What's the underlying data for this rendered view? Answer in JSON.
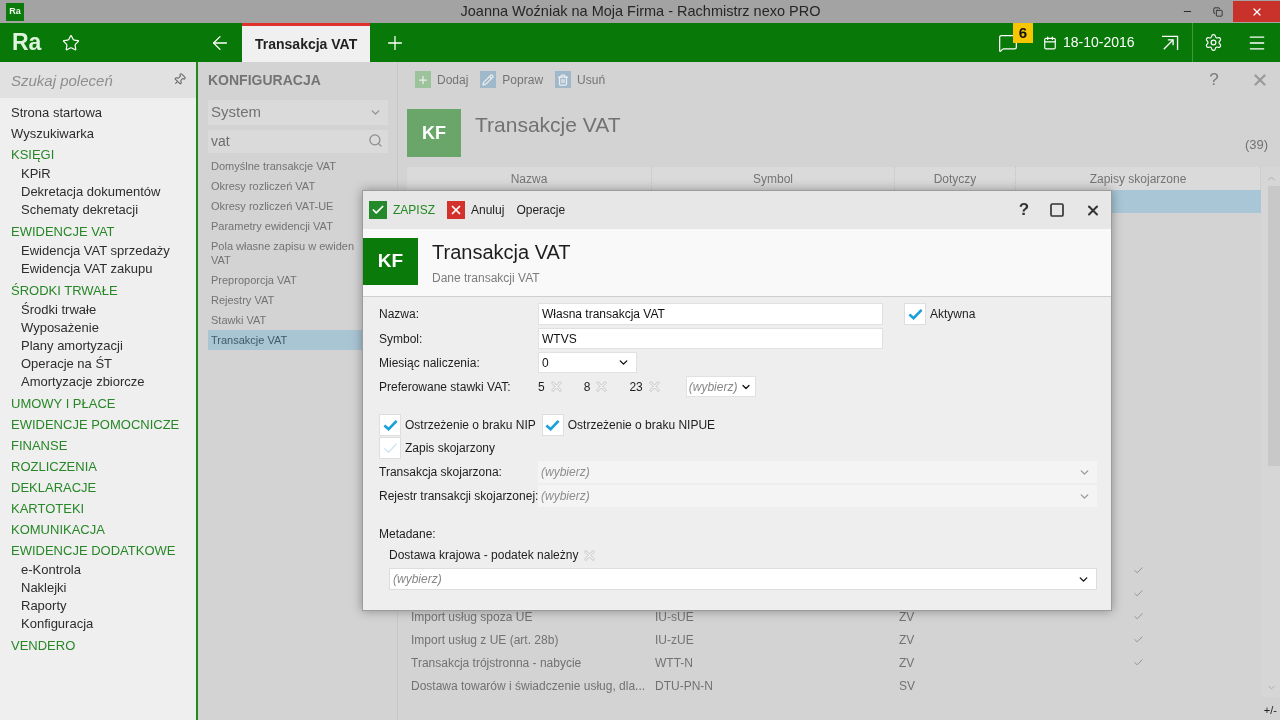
{
  "window": {
    "icon_text": "Ra",
    "title": "Joanna Woźniak na Moja Firma - Rachmistrz nexo PRO"
  },
  "app_bar": {
    "logo": "Ra",
    "tabs": [
      {
        "label": "Transakcja VAT",
        "selected": true
      }
    ],
    "badge": "6",
    "date": "18-10-2016"
  },
  "sidebar": {
    "search": {
      "placeholder": "Szukaj poleceń"
    },
    "items": [
      {
        "kind": "link",
        "label": "Strona startowa"
      },
      {
        "kind": "link",
        "label": "Wyszukiwarka"
      },
      {
        "kind": "section",
        "label": "KSIĘGI",
        "children": [
          {
            "label": "KPiR"
          },
          {
            "label": "Dekretacja dokumentów"
          },
          {
            "label": "Schematy dekretacji"
          }
        ]
      },
      {
        "kind": "section",
        "label": "EWIDENCJE VAT",
        "children": [
          {
            "label": "Ewidencja VAT sprzedaży"
          },
          {
            "label": "Ewidencja VAT zakupu"
          }
        ]
      },
      {
        "kind": "section",
        "label": "ŚRODKI TRWAŁE",
        "children": [
          {
            "label": "Środki trwałe"
          },
          {
            "label": "Wyposażenie"
          },
          {
            "label": "Plany amortyzacji"
          },
          {
            "label": "Operacje na ŚT"
          },
          {
            "label": "Amortyzacje zbiorcze"
          }
        ]
      },
      {
        "kind": "section",
        "label": "UMOWY I PŁACE"
      },
      {
        "kind": "section",
        "label": "EWIDENCJE POMOCNICZE"
      },
      {
        "kind": "section",
        "label": "FINANSE"
      },
      {
        "kind": "section",
        "label": "ROZLICZENIA"
      },
      {
        "kind": "section",
        "label": "DEKLARACJE"
      },
      {
        "kind": "section",
        "label": "KARTOTEKI"
      },
      {
        "kind": "section",
        "label": "KOMUNIKACJA"
      },
      {
        "kind": "section",
        "label": "EWIDENCJE DODATKOWE",
        "children": [
          {
            "label": "e-Kontrola"
          },
          {
            "label": "Naklejki"
          },
          {
            "label": "Raporty"
          },
          {
            "label": "Konfiguracja"
          }
        ]
      },
      {
        "kind": "section",
        "label": "VENDERO"
      }
    ]
  },
  "config_panel": {
    "title": "KONFIGURACJA",
    "category": "System",
    "search": {
      "value": "vat"
    },
    "items": [
      {
        "label": "Domyślne transakcje VAT",
        "selected": false
      },
      {
        "label": "Okresy rozliczeń VAT",
        "selected": false
      },
      {
        "label": "Okresy rozliczeń VAT-UE",
        "selected": false
      },
      {
        "label": "Parametry ewidencji VAT",
        "selected": false
      },
      {
        "label": "Pola własne zapisu w ewiden VAT",
        "selected": false
      },
      {
        "label": "Preproporcja VAT",
        "selected": false
      },
      {
        "label": "Rejestry VAT",
        "selected": false
      },
      {
        "label": "Stawki VAT",
        "selected": false
      },
      {
        "label": "Transakcje VAT",
        "selected": true
      }
    ]
  },
  "main": {
    "toolbar": [
      {
        "kind": "add",
        "label": "Dodaj"
      },
      {
        "kind": "edit",
        "label": "Popraw"
      },
      {
        "kind": "delete",
        "label": "Usuń"
      }
    ],
    "help": "?",
    "tile": "KF",
    "title": "Transakcje VAT",
    "count": "(39)",
    "table": {
      "columns": [
        "Nazwa",
        "Symbol",
        "Dotyczy",
        "Zapisy skojarzone"
      ],
      "rows": [
        {
          "selected": true,
          "linked": false
        },
        {
          "selected": false,
          "linked": true
        },
        {
          "selected": false,
          "linked": true
        },
        {
          "name": "Import usług spoza UE",
          "symbol": "IU-sUE",
          "applies_to": "ZV",
          "selected": false,
          "linked": true
        },
        {
          "name": "Import usług z UE (art. 28b)",
          "symbol": "IU-zUE",
          "applies_to": "ZV",
          "selected": false,
          "linked": true
        },
        {
          "name": "Transakcja trójstronna - nabycie",
          "symbol": "WTT-N",
          "applies_to": "ZV",
          "selected": false,
          "linked": true
        },
        {
          "name": "Dostawa towarów i świadczenie usług, dla...",
          "symbol": "DTU-PN-N",
          "applies_to": "SV",
          "selected": false,
          "linked": false
        }
      ]
    },
    "footer": "+/-"
  },
  "dialog": {
    "toolbar": [
      {
        "kind": "save",
        "label": "ZAPISZ"
      },
      {
        "kind": "cancel",
        "label": "Anuluj"
      },
      {
        "kind": "plain",
        "label": "Operacje"
      }
    ],
    "help": "?",
    "tile": "KF",
    "title": "Transakcja VAT",
    "subtitle": "Dane transakcji VAT",
    "form": {
      "name": {
        "label": "Nazwa:",
        "value": "Własna transakcja VAT"
      },
      "active": {
        "label": "Aktywna",
        "checked": true
      },
      "symbol": {
        "label": "Symbol:",
        "value": "WTVS"
      },
      "month": {
        "label": "Miesiąc naliczenia:",
        "value": "0"
      },
      "rates": {
        "label": "Preferowane stawki VAT:",
        "tags": [
          "5",
          "8",
          "23"
        ],
        "placeholder": "(wybierz)"
      },
      "options": [
        {
          "label": "Ostrzeżenie o braku NIP",
          "checked": true
        },
        {
          "label": "Ostrzeżenie o braku NIPUE",
          "checked": true
        },
        {
          "label": "Zapis skojarzony",
          "checked": false
        }
      ],
      "linked": [
        {
          "label": "Transakcja skojarzona:",
          "placeholder": "(wybierz)",
          "disabled": true
        },
        {
          "label": "Rejestr transakcji skojarzonej:",
          "placeholder": "(wybierz)",
          "disabled": true
        }
      ],
      "metadata": {
        "label": "Metadane:",
        "tags": [
          "Dostawa krajowa - podatek należny"
        ],
        "placeholder": "(wybierz)"
      }
    }
  }
}
